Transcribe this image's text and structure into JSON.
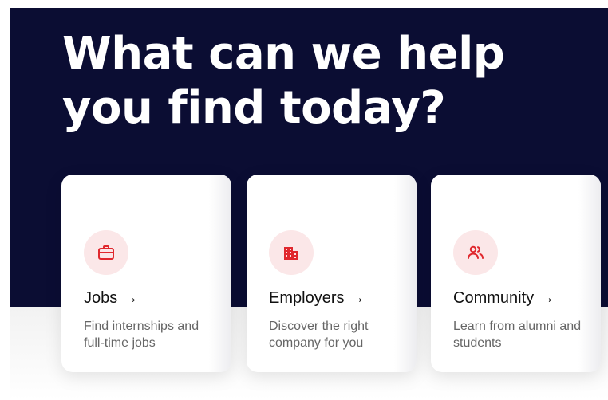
{
  "hero": {
    "headline": "What can we help you find today?",
    "background_color": "#0b0d33"
  },
  "accent_color": "#e0282e",
  "cards": [
    {
      "title": "Jobs",
      "arrow": "→",
      "description": "Find internships and full-time jobs",
      "icon": "briefcase-icon"
    },
    {
      "title": "Employers",
      "arrow": "→",
      "description": "Discover the right company for you",
      "icon": "building-icon"
    },
    {
      "title": "Community",
      "arrow": "→",
      "description": "Learn from alumni and students",
      "icon": "people-icon"
    }
  ]
}
